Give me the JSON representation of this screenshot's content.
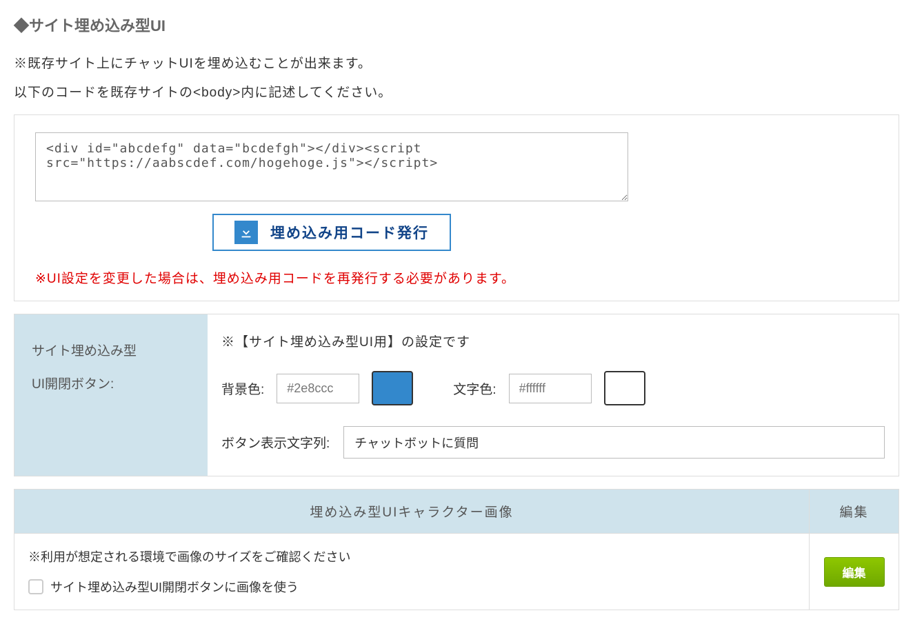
{
  "section": {
    "title": "◆サイト埋め込み型UI",
    "desc1": "※既存サイト上にチャットUIを埋め込むことが出来ます。",
    "desc2": "以下のコードを既存サイトの<body>内に記述してください。"
  },
  "codebox": {
    "code": "<div id=\"abcdefg\" data=\"bcdefgh\"></div><script src=\"https://aabscdef.com/hogehoge.js\"></script>",
    "button_label": "埋め込み用コード発行",
    "warning": "※UI設定を変更した場合は、埋め込み用コードを再発行する必要があります。"
  },
  "settings": {
    "side_label_line1": "サイト埋め込み型",
    "side_label_line2": "UI開閉ボタン:",
    "note": "※【サイト埋め込み型UI用】の設定です",
    "bgcolor_label": "背景色:",
    "bgcolor_value": "#2e8ccc",
    "fgcolor_label": "文字色:",
    "fgcolor_value": "#ffffff",
    "btntext_label": "ボタン表示文字列:",
    "btntext_value": "チャットボットに質問"
  },
  "image_table": {
    "header_image": "埋め込み型UIキャラクター画像",
    "header_edit": "編集",
    "note": "※利用が想定される環境で画像のサイズをご確認ください",
    "checkbox_label": "サイト埋め込み型UI開閉ボタンに画像を使う",
    "edit_button": "編集"
  },
  "colors": {
    "swatch_bg": "#3388cc",
    "swatch_fg": "#ffffff"
  }
}
